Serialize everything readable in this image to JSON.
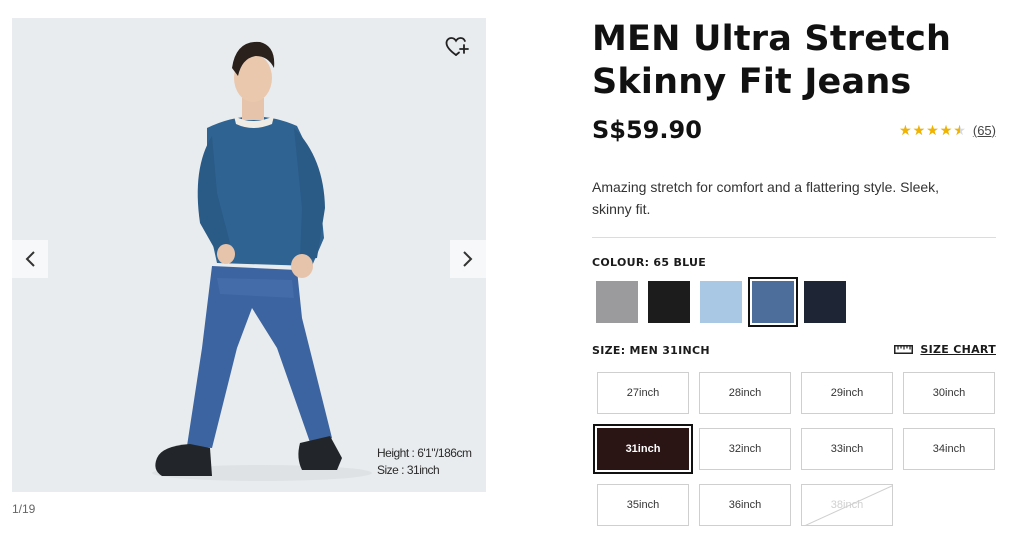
{
  "gallery": {
    "counter": "1/19",
    "model_info": {
      "height": "Height : 6'1\"/186cm",
      "size": "Size : 31inch"
    }
  },
  "product": {
    "title_line1": "MEN Ultra Stretch",
    "title_line2": "Skinny Fit Jeans",
    "price": "S$59.90",
    "rating": {
      "stars": "★★★★★",
      "value": 4.5,
      "max": 5,
      "count": "(65)"
    },
    "description": "Amazing stretch for comfort and a flattering style. Sleek, skinny fit."
  },
  "colour": {
    "label": "COLOUR: 65 BLUE",
    "swatches": [
      {
        "name": "gray",
        "color": "#9b9b9d"
      },
      {
        "name": "black",
        "color": "#1c1c1c"
      },
      {
        "name": "light-blue",
        "color": "#a9c8e4"
      },
      {
        "name": "blue",
        "color": "#4d6d9b",
        "selected": true
      },
      {
        "name": "navy",
        "color": "#1e2636"
      }
    ]
  },
  "size": {
    "label": "SIZE: MEN 31INCH",
    "chart_label": "SIZE CHART",
    "options": [
      {
        "label": "27inch"
      },
      {
        "label": "28inch"
      },
      {
        "label": "29inch"
      },
      {
        "label": "30inch"
      },
      {
        "label": "31inch",
        "selected": true
      },
      {
        "label": "32inch"
      },
      {
        "label": "33inch"
      },
      {
        "label": "34inch"
      },
      {
        "label": "35inch"
      },
      {
        "label": "36inch"
      },
      {
        "label": "38inch",
        "disabled": true
      }
    ]
  },
  "colors": {
    "star": "#f0b400",
    "sweater": "#2f6391",
    "jeans": "#3c64a0",
    "shoes": "#22262b",
    "selected_size_bg": "#2a1414"
  }
}
